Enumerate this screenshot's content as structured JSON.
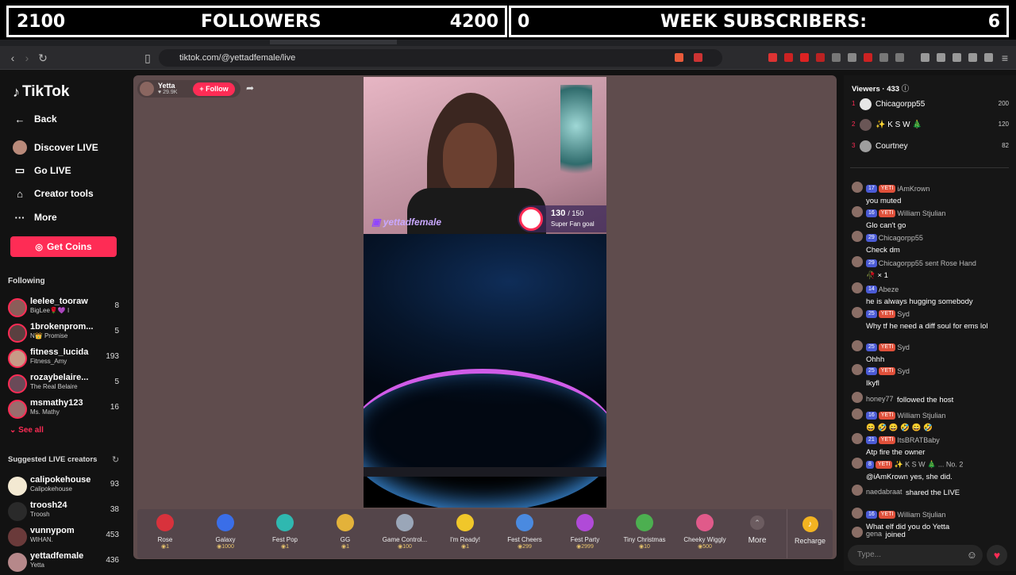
{
  "overlay": {
    "followers_current": "2100",
    "followers_label": "FOLLOWERS",
    "followers_goal": "4200",
    "subs_current": "0",
    "subs_label": "WEEK SUBSCRIBERS:",
    "subs_goal": "6"
  },
  "browser": {
    "url": "tiktok.com/@yettadfemale/live"
  },
  "sidebar": {
    "logo": "TikTok",
    "nav": [
      {
        "label": "Back",
        "icon": "back-arrow-icon"
      },
      {
        "label": "Discover LIVE",
        "icon": "live-avatar-icon"
      },
      {
        "label": "Go LIVE",
        "icon": "camera-icon"
      },
      {
        "label": "Creator tools",
        "icon": "home-icon"
      },
      {
        "label": "More",
        "icon": "more-dots-icon"
      }
    ],
    "get_coins": "Get Coins",
    "following_heading": "Following",
    "following": [
      {
        "name": "leelee_tooraw",
        "sub": "BigLee🌹💜 I",
        "count": "8"
      },
      {
        "name": "1brokenprom...",
        "sub": "N👑 Promise",
        "count": "5"
      },
      {
        "name": "fitness_lucida",
        "sub": "Fitness_Amy",
        "count": "193"
      },
      {
        "name": "rozaybelaire...",
        "sub": "The Real Belaire",
        "count": "5"
      },
      {
        "name": "msmathy123",
        "sub": "Ms. Mathy",
        "count": "16"
      }
    ],
    "see_all": "See all",
    "suggested_heading": "Suggested LIVE creators",
    "suggested": [
      {
        "name": "calipokehouse",
        "sub": "Calipokehouse",
        "count": "93"
      },
      {
        "name": "troosh24",
        "sub": "Troosh",
        "count": "38"
      },
      {
        "name": "vunnypom",
        "sub": "WIHAN.",
        "count": "453"
      },
      {
        "name": "yettadfemale",
        "sub": "Yetta",
        "count": "436"
      }
    ]
  },
  "stream": {
    "host_name": "Yetta",
    "host_likes": "29.9K",
    "follow_label": "+ Follow",
    "goal_current": "130",
    "goal_total": "/ 150",
    "goal_label": "Super Fan goal",
    "watermark": "yettadfemale"
  },
  "gifts": [
    {
      "name": "Rose",
      "price": "1",
      "color": "#d8323c"
    },
    {
      "name": "Galaxy",
      "price": "1000",
      "color": "#3a6ee8"
    },
    {
      "name": "Fest Pop",
      "price": "1",
      "color": "#2fb8b0"
    },
    {
      "name": "GG",
      "price": "1",
      "color": "#e3b23a"
    },
    {
      "name": "Game Control...",
      "price": "100",
      "color": "#9aa6b8"
    },
    {
      "name": "I'm Ready!",
      "price": "1",
      "color": "#f0c72a"
    },
    {
      "name": "Fest Cheers",
      "price": "299",
      "color": "#4a8ae0"
    },
    {
      "name": "Fest Party",
      "price": "2999",
      "color": "#b04ad8"
    },
    {
      "name": "Tiny Christmas",
      "price": "10",
      "color": "#4caf50"
    },
    {
      "name": "Cheeky Wiggly",
      "price": "500",
      "color": "#e05a8a"
    }
  ],
  "gift_more": "More",
  "recharge": "Recharge",
  "viewers": {
    "label": "Viewers",
    "count": "433",
    "top": [
      {
        "rank": "1",
        "name": "Chicagorpp55",
        "score": "200"
      },
      {
        "rank": "2",
        "name": "✨ K S W 🎄",
        "score": "120"
      },
      {
        "rank": "3",
        "name": "Courtney",
        "score": "82"
      }
    ]
  },
  "chat": [
    {
      "level": "17",
      "yeti": true,
      "name": "iAmKrown",
      "text": "you muted"
    },
    {
      "level": "16",
      "yeti": true,
      "name": "William Stjulian",
      "text": "Glo can't go"
    },
    {
      "level": "29",
      "yeti": false,
      "name": "Chicagorpp55",
      "text": "Check dm"
    },
    {
      "level": "29",
      "yeti": false,
      "name": "Chicagorpp55 sent Rose Hand",
      "text": "🥀 × 1"
    },
    {
      "level": "14",
      "yeti": false,
      "name": "Abeze",
      "text": "he is always hugging somebody"
    },
    {
      "level": "25",
      "yeti": true,
      "name": "Syd",
      "text": "Why tf he need a diff soul for ems lol"
    },
    {
      "level": "25",
      "yeti": true,
      "name": "Syd",
      "text": "Ohhh"
    },
    {
      "level": "25",
      "yeti": true,
      "name": "Syd",
      "text": "Ikyfl"
    },
    {
      "level": "",
      "yeti": false,
      "name": "honey77",
      "text": "followed the host"
    },
    {
      "level": "16",
      "yeti": true,
      "name": "William Stjulian",
      "text": "😄 🤣 😄 🤣 😄 🤣"
    },
    {
      "level": "21",
      "yeti": true,
      "name": "ItsBRATBaby",
      "text": "Atp fire the owner"
    },
    {
      "level": "8",
      "yeti": true,
      "name": "✨ K S W 🎄 ... No. 2",
      "text": "@iAmKrown yes, she did."
    },
    {
      "level": "",
      "yeti": false,
      "name": "naedabraat",
      "text": "shared the LIVE"
    },
    {
      "level": "16",
      "yeti": true,
      "name": "William Stjulian",
      "text": "What elf did you do Yetta"
    },
    {
      "level": "",
      "yeti": false,
      "name": "gena",
      "text": "joined"
    }
  ],
  "chat_input": {
    "placeholder": "Type..."
  },
  "badges": {
    "yeti": "YETI"
  }
}
